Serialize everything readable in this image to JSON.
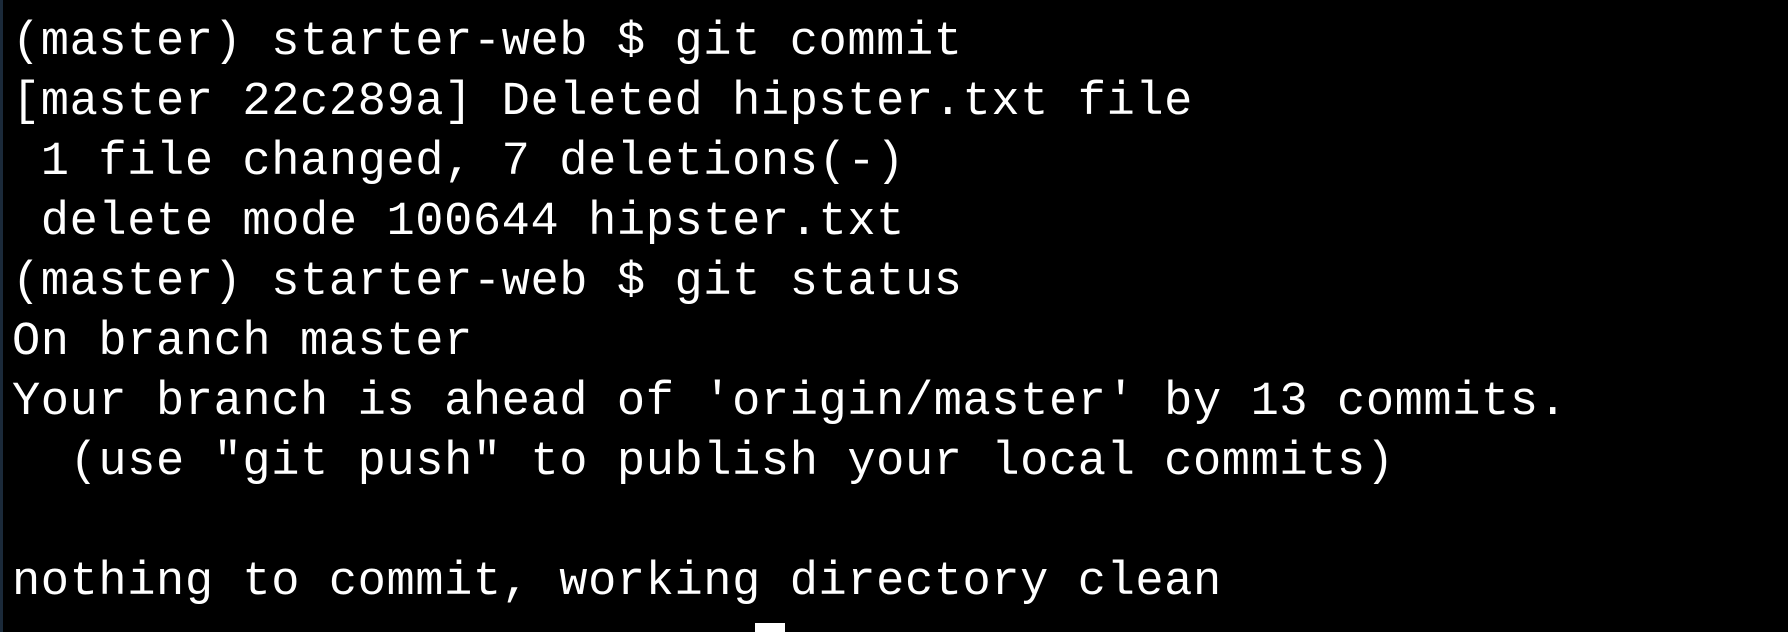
{
  "terminal": {
    "lines": [
      "(master) starter-web $ git commit",
      "[master 22c289a] Deleted hipster.txt file",
      " 1 file changed, 7 deletions(-)",
      " delete mode 100644 hipster.txt",
      "(master) starter-web $ git status",
      "On branch master",
      "Your branch is ahead of 'origin/master' by 13 commits.",
      "  (use \"git push\" to publish your local commits)",
      "",
      "nothing to commit, working directory clean"
    ]
  },
  "colors": {
    "background": "#000000",
    "foreground": "#ffffff"
  }
}
